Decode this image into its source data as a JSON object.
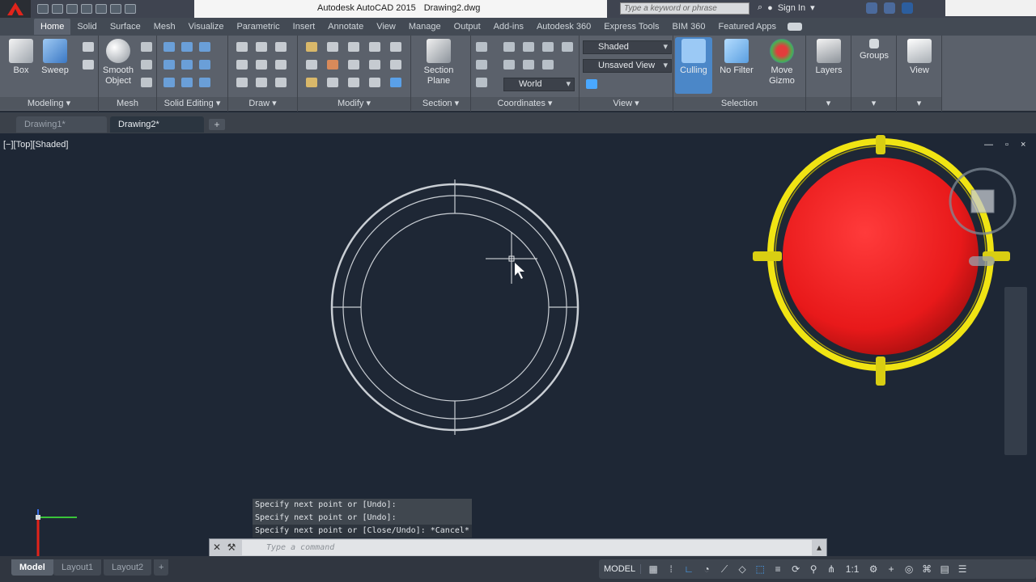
{
  "app": {
    "title": "Autodesk AutoCAD 2015",
    "document": "Drawing2.dwg",
    "search_placeholder": "Type a keyword or phrase",
    "sign_in": "Sign In"
  },
  "ribbon_tabs": [
    "Home",
    "Solid",
    "Surface",
    "Mesh",
    "Visualize",
    "Parametric",
    "Insert",
    "Annotate",
    "View",
    "Manage",
    "Output",
    "Add-ins",
    "Autodesk 360",
    "Express Tools",
    "BIM 360",
    "Featured Apps"
  ],
  "active_tab": "Home",
  "ribbon": {
    "box": "Box",
    "sweep": "Sweep",
    "smooth_object": "Smooth Object",
    "section_plane": "Section Plane",
    "culling": "Culling",
    "no_filter": "No Filter",
    "move_gizmo": "Move Gizmo",
    "layers": "Layers",
    "groups": "Groups",
    "view": "View",
    "visual_style": "Shaded",
    "saved_view": "Unsaved View",
    "ucs": "World",
    "panels": {
      "modeling": "Modeling",
      "mesh": "Mesh",
      "solid_editing": "Solid Editing",
      "draw": "Draw",
      "modify": "Modify",
      "section": "Section",
      "coordinates": "Coordinates",
      "view": "View",
      "selection": "Selection"
    }
  },
  "doc_tabs": [
    "Drawing1*",
    "Drawing2*"
  ],
  "viewport": {
    "label": "[−][Top][Shaded]",
    "controls": "— ▫ ×"
  },
  "command": {
    "history": [
      "Specify next point or [Undo]:",
      "Specify next point or [Undo]:",
      "Specify next point or [Close/Undo]: *Cancel*"
    ],
    "placeholder": "Type a command"
  },
  "layout_tabs": [
    "Model",
    "Layout1",
    "Layout2"
  ],
  "status": {
    "space": "MODEL",
    "scale": "1:1"
  },
  "colors": {
    "viewport_bg": "#1e2735",
    "sphere": "#e8191a",
    "gizmo_ring": "#f0e413"
  }
}
